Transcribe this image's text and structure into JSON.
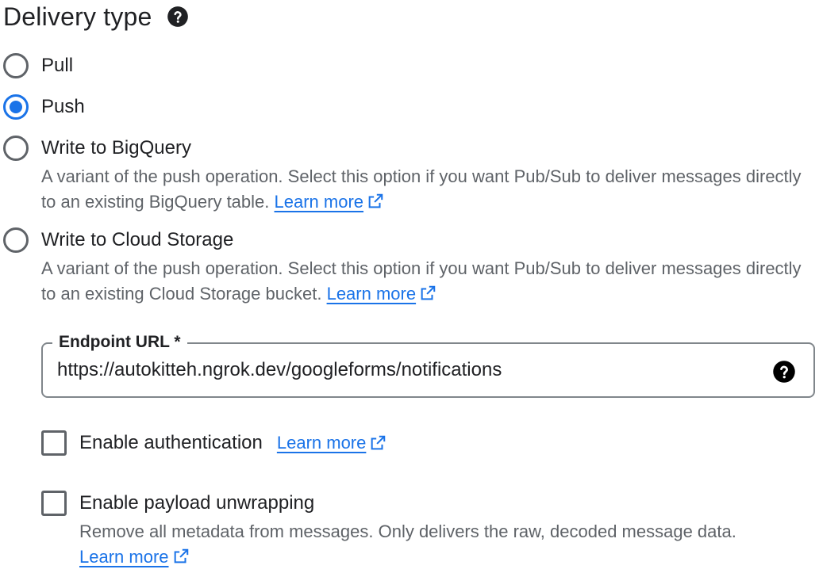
{
  "section": {
    "title": "Delivery type"
  },
  "delivery_options": [
    {
      "label": "Pull",
      "selected": false
    },
    {
      "label": "Push",
      "selected": true
    },
    {
      "label": "Write to BigQuery",
      "selected": false,
      "description": "A variant of the push operation. Select this option if you want Pub/Sub to deliver messages directly to an existing BigQuery table.",
      "link": "Learn more"
    },
    {
      "label": "Write to Cloud Storage",
      "selected": false,
      "description": "A variant of the push operation. Select this option if you want Pub/Sub to deliver messages directly to an existing Cloud Storage bucket.",
      "link": "Learn more"
    }
  ],
  "endpoint": {
    "label": "Endpoint URL *",
    "value": "https://autokitteh.ngrok.dev/googleforms/notifications"
  },
  "authentication": {
    "label": "Enable authentication",
    "checked": false,
    "link": "Learn more"
  },
  "payload_unwrapping": {
    "label": "Enable payload unwrapping",
    "checked": false,
    "description": "Remove all metadata from messages. Only delivers the raw, decoded message data.",
    "link": "Learn more"
  },
  "icons": {
    "help": "help-circle-icon",
    "external": "open-in-new-icon"
  },
  "colors": {
    "accent": "#1a73e8",
    "text": "#202124",
    "secondary_text": "#5f6368",
    "border": "#80868b"
  }
}
